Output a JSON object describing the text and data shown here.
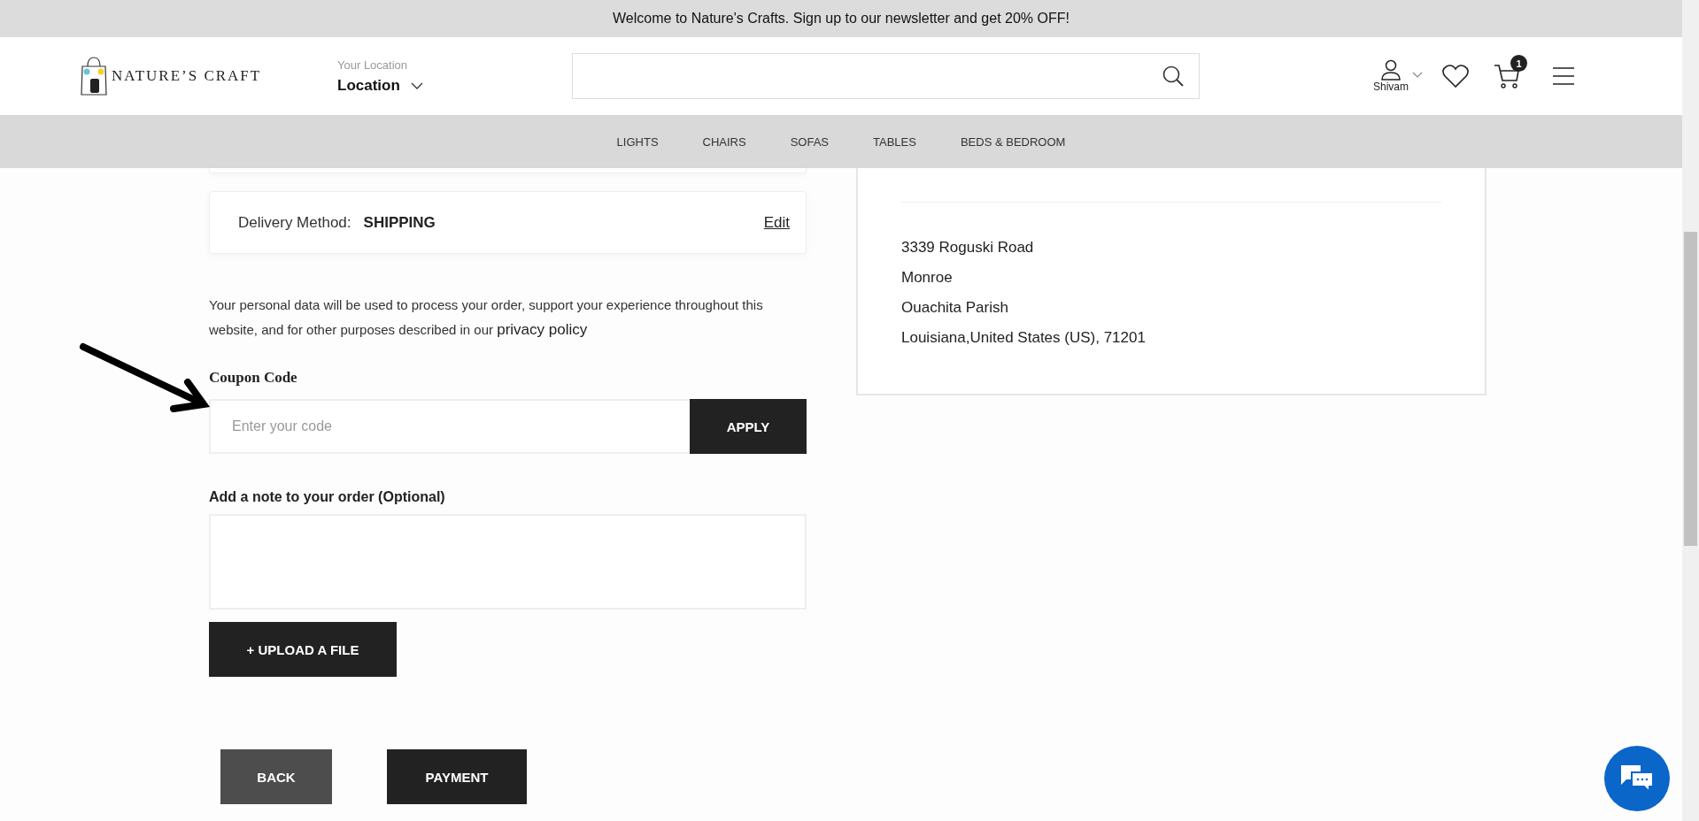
{
  "announcement": "Welcome to Nature's Crafts. Sign up to our newsletter and get 20% OFF!",
  "header": {
    "logo_text": "NATURE’S CRAFT",
    "location_label": "Your Location",
    "location_value": "Location",
    "user_name": "Shivam",
    "cart_count": "1"
  },
  "nav": [
    "LIGHTS",
    "CHAIRS",
    "SOFAS",
    "TABLES",
    "BEDS & BEDROOM"
  ],
  "delivery": {
    "label": "Delivery Method:",
    "value": "SHIPPING",
    "edit": "Edit"
  },
  "privacy": {
    "text": "Your personal data will be used to process your order, support your experience throughout this website, and for other purposes described in our",
    "link": "privacy policy"
  },
  "coupon": {
    "label": "Coupon Code",
    "placeholder": "Enter your code",
    "button": "APPLY"
  },
  "note": {
    "label": "Add a note to your order (Optional)"
  },
  "upload_button": "+ UPLOAD A FILE",
  "actions": [
    {
      "kind": "secondary",
      "label": "BACK"
    },
    {
      "kind": "primary",
      "label": "PAYMENT"
    }
  ],
  "address": [
    "3339 Roguski Road",
    "Monroe",
    "Ouachita Parish",
    "Louisiana,United States (US), 71201"
  ]
}
